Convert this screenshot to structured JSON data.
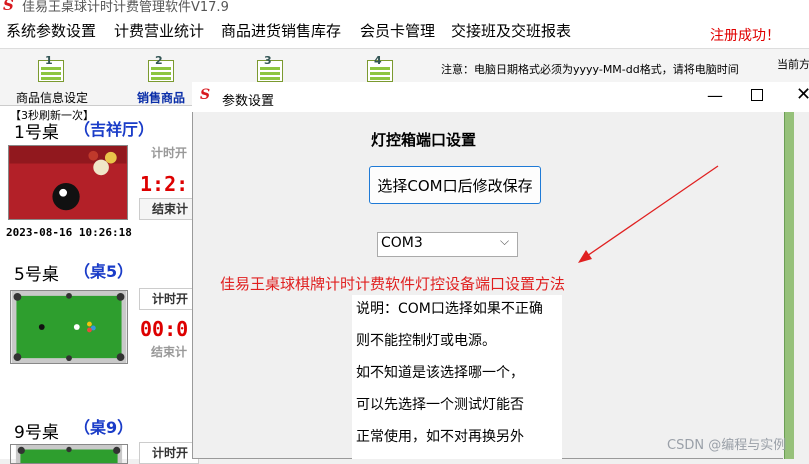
{
  "app": {
    "title": "佳易王桌球计时计费管理软件V17.9"
  },
  "menu": {
    "items": [
      "系统参数设置",
      "计费营业统计",
      "商品进货销售库存",
      "会员卡管理",
      "交接班及交班报表"
    ],
    "register_msg": "注册成功！"
  },
  "toolbar": {
    "buttons": [
      {
        "num": "1",
        "label": "商品信息设定"
      },
      {
        "num": "2",
        "label": "销售商品"
      },
      {
        "num": "3",
        "label": ""
      },
      {
        "num": "4",
        "label": ""
      }
    ],
    "notice": "注意：电脑日期格式必须为yyyy-MM-dd格式，请将电脑时间",
    "current_label": "当前方"
  },
  "left_panel": {
    "refresh_note": "【3秒刷新一次】",
    "tables": [
      {
        "name": "1号桌",
        "alias": "（吉祥厅）",
        "start_label": "计时开",
        "timer": "1:2:",
        "end_label": "结束计",
        "timestamp": "2023-08-16 10:26:18"
      },
      {
        "name": "5号桌",
        "alias": "（桌5）",
        "start_label": "计时开",
        "timer": "00:0",
        "end_label": "结束计"
      },
      {
        "name": "9号桌",
        "alias": "（桌9）",
        "start_label": "计时开"
      }
    ]
  },
  "dialog": {
    "title": "参数设置",
    "section_title": "灯控箱端口设置",
    "save_button": "选择COM口后修改保存",
    "com_selected": "COM3",
    "annotation": "佳易王桌球棋牌计时计费软件灯控设备端口设置方法",
    "description_lines": [
      "说明：COM口选择如果不正确",
      "则不能控制灯或电源。",
      "如不知道是该选择哪一个，",
      "可以先选择一个测试灯能否",
      "正常使用，如不对再换另外"
    ]
  },
  "watermark": "CSDN @编程与实例",
  "colors": {
    "accent": "#1e7ad6",
    "alert": "#e02020",
    "alias_blue": "#1a3cc8",
    "table_green": "#2e9e2e"
  }
}
